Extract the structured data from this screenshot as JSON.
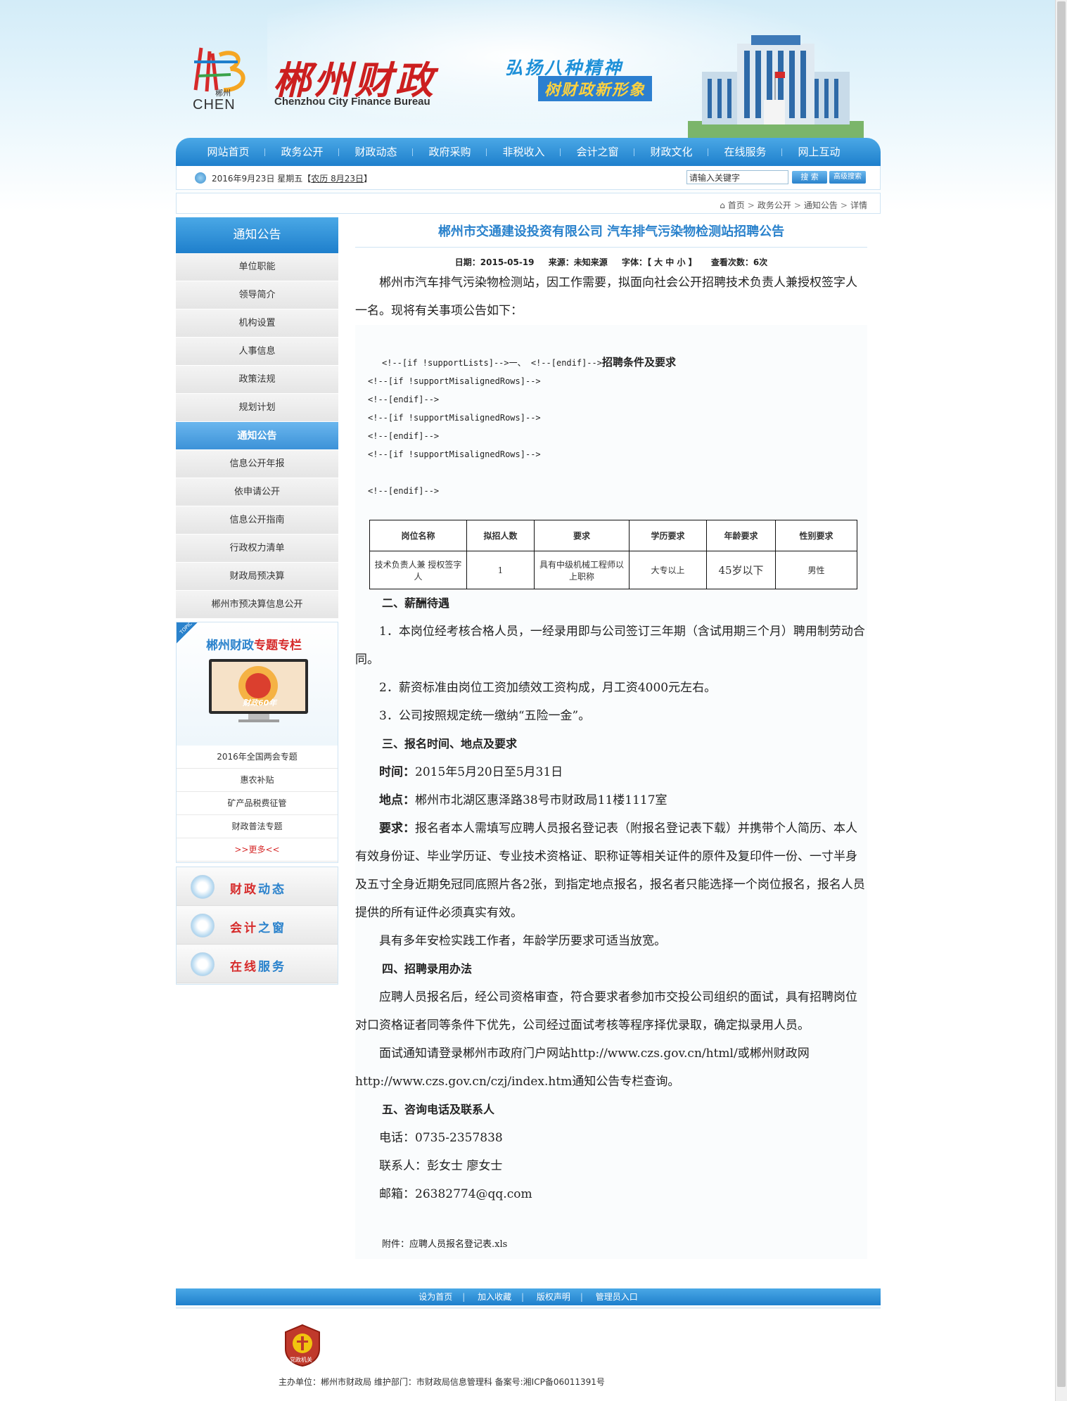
{
  "header": {
    "logo_cn": "郴州",
    "logo_en_short": "CHEN",
    "site_title": "郴州财政",
    "site_title_en": "Chenzhou City Finance Bureau",
    "slogan_line1": "弘扬八种精神",
    "slogan_line2": "树财政新形象"
  },
  "nav": {
    "items": [
      "网站首页",
      "政务公开",
      "财政动态",
      "政府采购",
      "非税收入",
      "会计之窗",
      "财政文化",
      "在线服务",
      "网上互动"
    ]
  },
  "datebar": {
    "date": "2016年9月23日 星期五【",
    "lunar_label": "农历 8月23日",
    "date_end": "】",
    "search_placeholder": "请输入关键字",
    "search_button": "搜 索",
    "advanced_search_button": "高级搜索"
  },
  "breadcrumb": {
    "items": [
      "首页",
      "政务公开",
      "通知公告",
      "详情"
    ],
    "separator": ">"
  },
  "sidebar": {
    "title": "通知公告",
    "items": [
      "单位职能",
      "领导简介",
      "机构设置",
      "人事信息",
      "政策法规",
      "规划计划",
      "通知公告",
      "信息公开年报",
      "依申请公开",
      "信息公开指南",
      "行政权力清单",
      "财政局预决算",
      "郴州市预决算信息公开"
    ],
    "active_index": 6
  },
  "topic": {
    "tag": "TOPIC",
    "title_blue": "郴州财政",
    "title_red": "专题专栏",
    "banner_text": "财政60年",
    "items": [
      "2016年全国两会专题",
      "惠农补贴",
      "矿产品税费征管",
      "财政普法专题"
    ],
    "more": ">>更多<<"
  },
  "quick_links": [
    {
      "red": "财政",
      "blue": "动态"
    },
    {
      "red": "会计",
      "blue": "之窗"
    },
    {
      "red": "在线",
      "blue": "服务"
    }
  ],
  "article": {
    "title": "郴州市交通建设投资有限公司  汽车排气污染物检测站招聘公告",
    "meta": {
      "date_label": "日期：",
      "date": "2015-05-19",
      "source_label": "来源：",
      "source": "未知来源",
      "font_label": "字体：",
      "font_sizes": "【 大 中 小 】",
      "views_label": "查看次数：",
      "views": "6次"
    },
    "intro": "郴州市汽车排气污染物检测站，因工作需要，拟面向社会公开招聘技术负责人兼授权签字人一名。现将有关事项公告如下：",
    "comment_1": "<!--[if !supportLists]-->一、 <!--[endif]-->",
    "section_1": "招聘条件及要求",
    "comments": [
      "<!--[if !supportMisalignedRows]-->",
      "<!--[endif]-->",
      "<!--[if !supportMisalignedRows]-->",
      "<!--[endif]-->",
      "<!--[if !supportMisalignedRows]-->",
      "",
      "<!--[endif]-->"
    ],
    "table": {
      "headers": [
        "岗位名称",
        "拟招人数",
        "要求",
        "学历要求",
        "年龄要求",
        "性别要求"
      ],
      "rows": [
        [
          "技术负责人兼   授权签字人",
          "1",
          "具有中级机械工程师以上职称",
          "大专以上",
          "45岁以下",
          "男性"
        ]
      ]
    },
    "section_2": "二、薪酬待遇",
    "salary": [
      "1．本岗位经考核合格人员，一经录用即与公司签订三年期（含试用期三个月）聘用制劳动合同。",
      "2．薪资标准由岗位工资加绩效工资构成，月工资4000元左右。",
      "3．公司按照规定统一缴纳“五险一金”。"
    ],
    "section_3": "三、报名时间、地点及要求",
    "time_label": "时间：",
    "time_value": "2015年5月20日至5月31日",
    "place_label": "地点：",
    "place_value": "郴州市北湖区惠泽路38号市财政局11楼1117室",
    "req_label": "要求：",
    "req_value": "报名者本人需填写应聘人员报名登记表（附报名登记表下载）并携带个人简历、本人有效身份证、毕业学历证、专业技术资格证、职称证等相关证件的原件及复印件一份、一寸半身及五寸全身近期免冠同底照片各2张，到指定地点报名，报名者只能选择一个岗位报名，报名人员提供的所有证件必须真实有效。",
    "relax": "具有多年安检实践工作者，年龄学历要求可适当放宽。",
    "section_4": "四、招聘录用办法",
    "method_1": "应聘人员报名后，经公司资格审查，符合要求者参加市交投公司组织的面试，具有招聘岗位对口资格证者同等条件下优先，公司经过面试考核等程序择优录取，确定拟录用人员。",
    "method_2": "面试通知请登录郴州市政府门户网站http://www.czs.gov.cn/html/或郴州财政网http://www.czs.gov.cn/czj/index.htm通知公告专栏查询。",
    "section_5": "五、咨询电话及联系人",
    "phone": "电话：0735-2357838",
    "contact": "联系人：彭女士 廖女士",
    "email": "邮箱：26382774@qq.com",
    "attachment": "附件：应聘人员报名登记表.xls"
  },
  "footer": {
    "links": [
      "设为首页",
      "加入收藏",
      "版权声明",
      "管理员入口"
    ],
    "seal_text": "党政机关",
    "info": "主办单位：郴州市财政局  维护部门：市财政局信息管理科  备案号:湘ICP备06011391号"
  },
  "colors": {
    "brand_blue": "#2a82cc",
    "accent_red": "#d62a2a"
  }
}
